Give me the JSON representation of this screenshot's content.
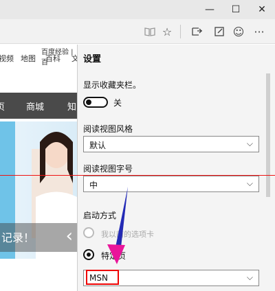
{
  "browser": {
    "toolbar_icons": [
      "reading-view-icon",
      "favorite-star-icon",
      "hub-icon",
      "web-note-icon",
      "feedback-smiley-icon",
      "more-icon"
    ]
  },
  "webpage": {
    "top_link": "百度经验 | 百",
    "nav_items": [
      "视频",
      "地图",
      "百科",
      "文"
    ],
    "dark_nav": [
      "页",
      "商城",
      "知"
    ],
    "banner_caption": "记录！"
  },
  "settings": {
    "title": "设置",
    "favorites_bar_label": "显示收藏夹栏。",
    "favorites_toggle_text": "关",
    "reading_style_label": "阅读视图风格",
    "reading_style_value": "默认",
    "reading_font_label": "阅读视图字号",
    "reading_font_value": "中",
    "startup_label": "启动方式",
    "startup_option_prev": "我以前的选项卡",
    "startup_option_page": "特定页",
    "startup_select_value": "MSN"
  }
}
